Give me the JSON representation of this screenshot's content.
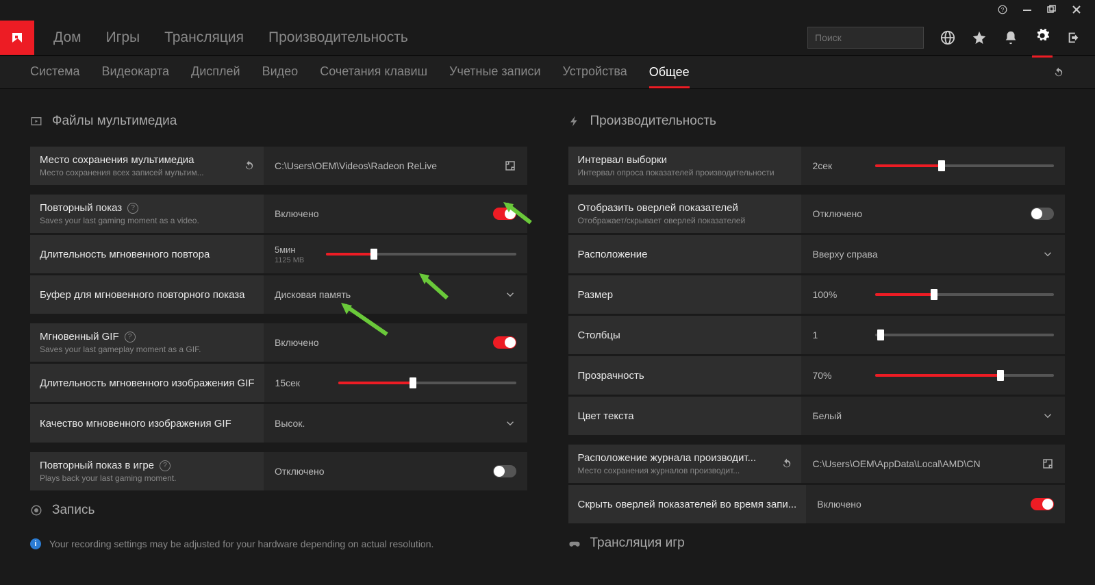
{
  "search_placeholder": "Поиск",
  "main_nav": {
    "home": "Дом",
    "games": "Игры",
    "streaming": "Трансляция",
    "performance": "Производительность"
  },
  "subnav": {
    "system": "Система",
    "gpu": "Видеокарта",
    "display": "Дисплей",
    "video": "Видео",
    "hotkeys": "Сочетания клавиш",
    "accounts": "Учетные записи",
    "devices": "Устройства",
    "general": "Общее"
  },
  "sections": {
    "media": "Файлы мультимедиа",
    "recording": "Запись",
    "performance": "Производительность",
    "game_streaming": "Трансляция игр"
  },
  "media": {
    "save_location": {
      "title": "Место сохранения мультимедиа",
      "sub": "Место сохранения всех записей мультим...",
      "path": "C:\\Users\\OEM\\Videos\\Radeon ReLive"
    },
    "replay": {
      "title": "Повторный показ",
      "sub": "Saves your last gaming moment as a video.",
      "value": "Включено"
    },
    "replay_duration": {
      "title": "Длительность мгновенного повтора",
      "value": "5мин",
      "size": "1125 MB"
    },
    "replay_buffer": {
      "title": "Буфер для мгновенного повторного показа",
      "value": "Дисковая память"
    },
    "gif": {
      "title": "Мгновенный GIF",
      "sub": "Saves your last gameplay moment as a GIF.",
      "value": "Включено"
    },
    "gif_duration": {
      "title": "Длительность мгновенного изображения GIF",
      "value": "15сек"
    },
    "gif_quality": {
      "title": "Качество мгновенного изображения GIF",
      "value": "Высок."
    },
    "ingame_replay": {
      "title": "Повторный показ в игре",
      "sub": "Plays back your last gaming moment.",
      "value": "Отключено"
    }
  },
  "perf": {
    "interval": {
      "title": "Интервал выборки",
      "sub": "Интервал опроса показателей производительности",
      "value": "2сек"
    },
    "overlay": {
      "title": "Отобразить оверлей показателей",
      "sub": "Отображает/скрывает оверлей показателей",
      "value": "Отключено"
    },
    "position": {
      "title": "Расположение",
      "value": "Вверху справа"
    },
    "size": {
      "title": "Размер",
      "value": "100%"
    },
    "columns": {
      "title": "Столбцы",
      "value": "1"
    },
    "transparency": {
      "title": "Прозрачность",
      "value": "70%"
    },
    "text_color": {
      "title": "Цвет текста",
      "value": "Белый"
    },
    "log_location": {
      "title": "Расположение журнала производит...",
      "sub": "Место сохранения журналов производит...",
      "path": "C:\\Users\\OEM\\AppData\\Local\\AMD\\CN"
    },
    "hide_overlay_recording": {
      "title": "Скрыть оверлей показателей во время запи...",
      "value": "Включено"
    }
  },
  "warning": "Your recording settings may be adjusted for your hardware depending on actual resolution."
}
